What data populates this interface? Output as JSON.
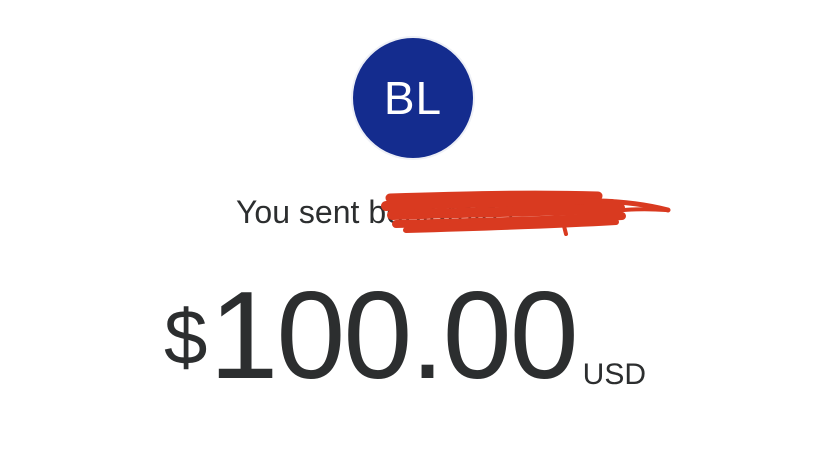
{
  "recipient": {
    "initials": "BL",
    "avatar_color": "#142c8e"
  },
  "transaction": {
    "sent_prefix": "You sent",
    "recipient_name": "benjamin l",
    "name_redacted": true,
    "redaction_color": "#d93a20"
  },
  "amount": {
    "currency_symbol": "$",
    "value": "100.00",
    "currency_code": "USD"
  }
}
